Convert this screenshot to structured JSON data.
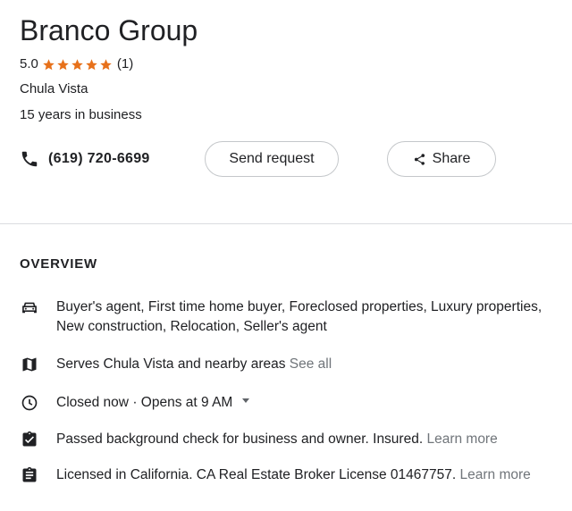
{
  "business": {
    "name": "Branco Group",
    "rating": "5.0",
    "star_count": 5,
    "review_count": "(1)",
    "location": "Chula Vista",
    "years_in_business": "15 years in business"
  },
  "actions": {
    "phone": "(619) 720-6699",
    "send_request_label": "Send request",
    "share_label": "Share"
  },
  "overview": {
    "heading": "OVERVIEW",
    "services": "Buyer's agent, First time home buyer, Foreclosed properties, Luxury properties, New construction, Relocation, Seller's agent",
    "service_area": "Serves Chula Vista and nearby areas",
    "service_area_link": "See all",
    "hours_status": "Closed now",
    "hours_separator": "·",
    "hours_next": "Opens at 9 AM",
    "background_check": "Passed background check for business and owner. Insured.",
    "background_check_link": "Learn more",
    "license": "Licensed in California. CA Real Estate Broker License 01467757.",
    "license_link": "Learn more"
  },
  "colors": {
    "star": "#e7711b",
    "text": "#202124",
    "muted": "#70757a",
    "border": "#dadce0"
  },
  "icons": {
    "phone": "phone-icon",
    "share": "share-icon",
    "services": "car-icon",
    "area": "map-icon",
    "hours": "clock-icon",
    "check": "clipboard-check-icon",
    "license": "clipboard-icon"
  }
}
